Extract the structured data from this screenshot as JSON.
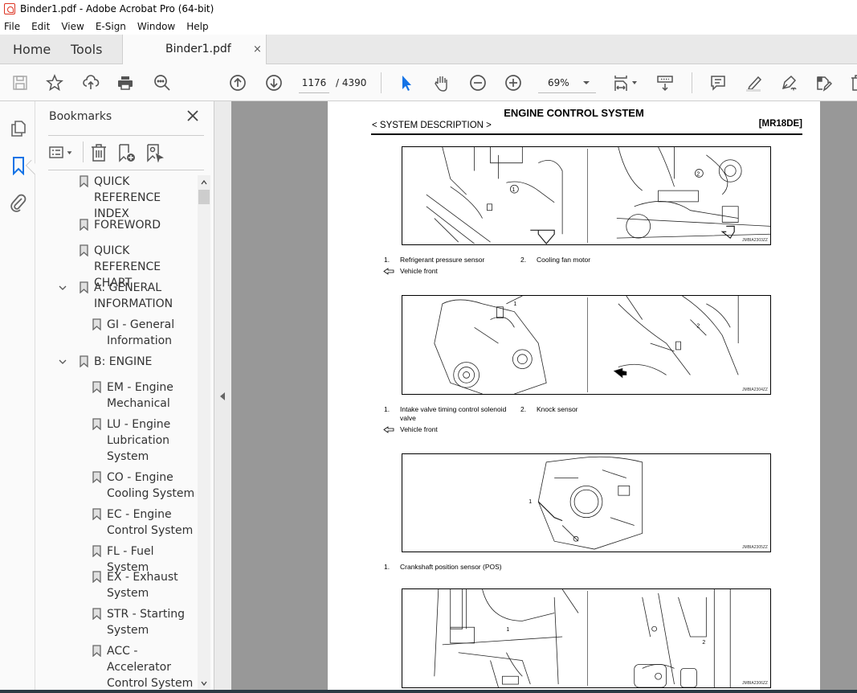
{
  "window": {
    "title": "Binder1.pdf - Adobe Acrobat Pro (64-bit)"
  },
  "menu": [
    "File",
    "Edit",
    "View",
    "E-Sign",
    "Window",
    "Help"
  ],
  "tabs": {
    "home": "Home",
    "tools": "Tools",
    "document": "Binder1.pdf",
    "close_symbol": "×"
  },
  "toolbar": {
    "icons": [
      "save-icon",
      "bookmark-star-icon",
      "upload-cloud-icon",
      "print-icon",
      "find-zoom-icon",
      "page-up-icon",
      "page-down-icon",
      "select-cursor-icon",
      "hand-icon",
      "zoom-out-icon",
      "zoom-in-icon",
      "fit-page-icon",
      "scroll-mode-icon",
      "comment-icon",
      "highlight-icon",
      "sign-icon",
      "edit-pdf-icon",
      "delete-icon"
    ],
    "current_page": "1176",
    "total_pages": "/ 4390",
    "zoom": "69%"
  },
  "bookmarks": {
    "title": "Bookmarks",
    "items": [
      {
        "label": "QUICK REFERENCE INDEX",
        "lines": [
          "QUICK REFERENCE",
          "INDEX"
        ],
        "level": 0,
        "expanded": null
      },
      {
        "label": "FOREWORD",
        "lines": [
          "FOREWORD"
        ],
        "level": 0,
        "expanded": null
      },
      {
        "label": "QUICK REFERENCE CHART",
        "lines": [
          "QUICK REFERENCE",
          "CHART"
        ],
        "level": 0,
        "expanded": null
      },
      {
        "label": "A: GENERAL INFORMATION",
        "lines": [
          "A: GENERAL",
          "INFORMATION"
        ],
        "level": 0,
        "expanded": true
      },
      {
        "label": "GI - General Information",
        "lines": [
          "GI - General",
          "Information"
        ],
        "level": 1,
        "expanded": null
      },
      {
        "label": "B: ENGINE",
        "lines": [
          "B: ENGINE"
        ],
        "level": 0,
        "expanded": true
      },
      {
        "label": "EM - Engine Mechanical",
        "lines": [
          "EM - Engine",
          "Mechanical"
        ],
        "level": 1,
        "expanded": null
      },
      {
        "label": "LU - Engine Lubrication System",
        "lines": [
          "LU - Engine",
          "Lubrication",
          "System"
        ],
        "level": 1,
        "expanded": null
      },
      {
        "label": "CO - Engine Cooling System",
        "lines": [
          "CO - Engine",
          "Cooling System"
        ],
        "level": 1,
        "expanded": null
      },
      {
        "label": "EC - Engine Control System",
        "lines": [
          "EC - Engine",
          "Control System"
        ],
        "level": 1,
        "expanded": null
      },
      {
        "label": "FL - Fuel System",
        "lines": [
          "FL - Fuel System"
        ],
        "level": 1,
        "expanded": null
      },
      {
        "label": "EX - Exhaust System",
        "lines": [
          "EX - Exhaust",
          "System"
        ],
        "level": 1,
        "expanded": null
      },
      {
        "label": "STR - Starting System",
        "lines": [
          "STR - Starting",
          "System"
        ],
        "level": 1,
        "expanded": null
      },
      {
        "label": "ACC - Accelerator Control System",
        "lines": [
          "ACC -",
          "Accelerator",
          "Control System"
        ],
        "level": 1,
        "expanded": null
      }
    ]
  },
  "document": {
    "title": "ENGINE CONTROL SYSTEM",
    "section": "< SYSTEM DESCRIPTION >",
    "code": "[MR18DE]",
    "figures": [
      {
        "code": "JMBIA2303ZZ",
        "captions": [
          {
            "num": "1.",
            "text": "Refrigerant pressure sensor"
          },
          {
            "num": "2.",
            "text": "Cooling fan motor"
          }
        ],
        "vehicle_front": "Vehicle front"
      },
      {
        "code": "JMBIA2304ZZ",
        "captions": [
          {
            "num": "1.",
            "text": "Intake valve timing control solenoid valve"
          },
          {
            "num": "2.",
            "text": "Knock sensor"
          }
        ],
        "vehicle_front": "Vehicle front"
      },
      {
        "code": "JMBIA2305ZZ",
        "captions": [
          {
            "num": "1.",
            "text": "Crankshaft position sensor (POS)"
          }
        ],
        "vehicle_front": null
      },
      {
        "code": "JMBIA2306ZZ",
        "captions": [],
        "vehicle_front": null
      }
    ]
  },
  "colors": {
    "accent_blue": "#1473e6",
    "app_red": "#d32f2f"
  }
}
